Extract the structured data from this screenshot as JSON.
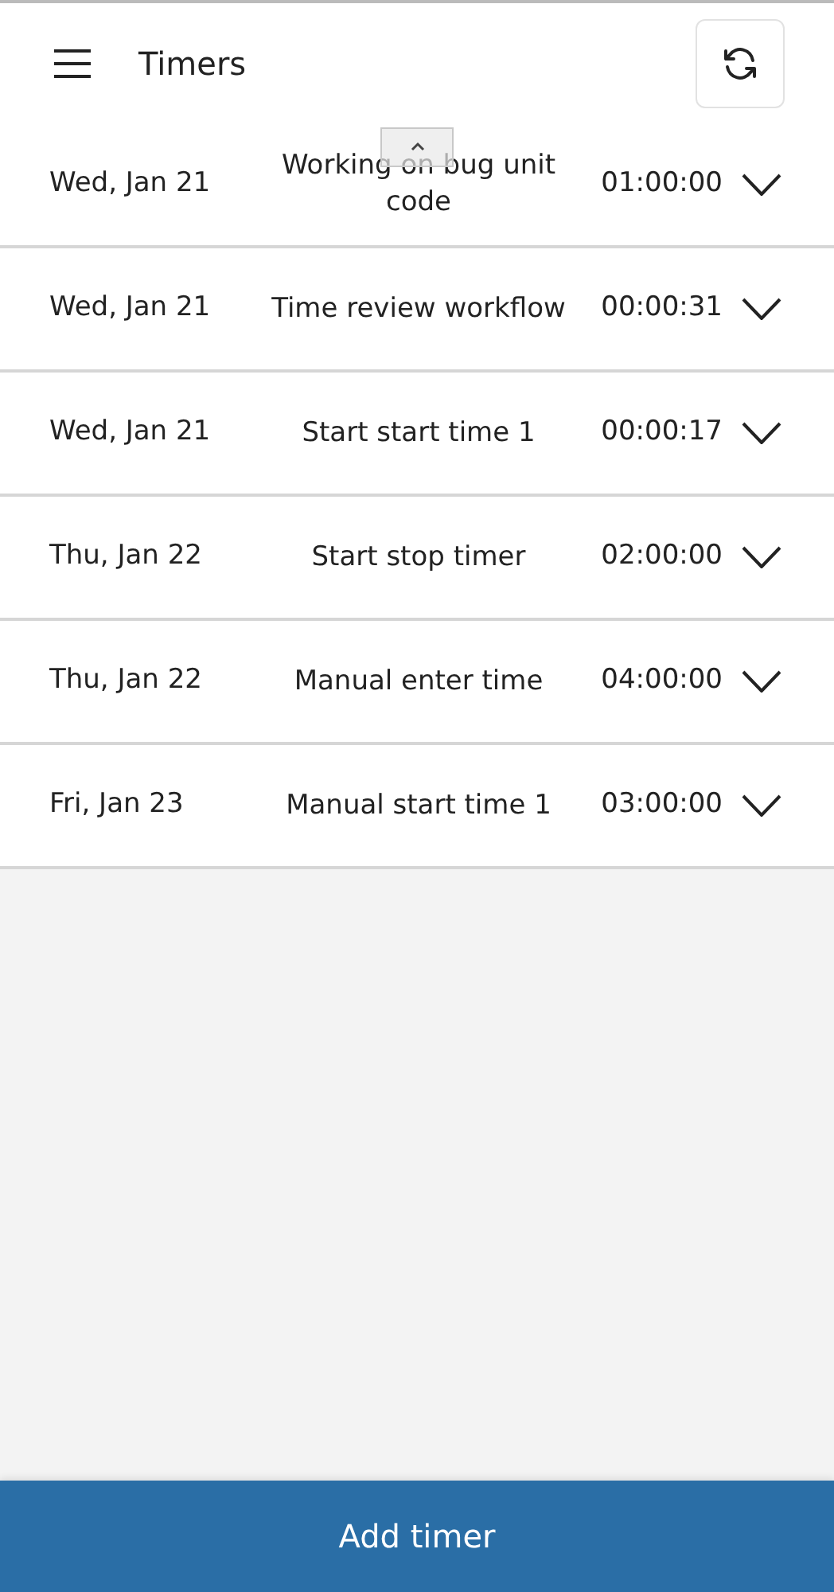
{
  "header": {
    "title": "Timers"
  },
  "timers": [
    {
      "date": "Wed, Jan 21",
      "title": "Working on bug unit code",
      "duration": "01:00:00"
    },
    {
      "date": "Wed, Jan 21",
      "title": "Time review workflow",
      "duration": "00:00:31"
    },
    {
      "date": "Wed, Jan 21",
      "title": "Start start time 1",
      "duration": "00:00:17"
    },
    {
      "date": "Thu, Jan 22",
      "title": "Start stop timer",
      "duration": "02:00:00"
    },
    {
      "date": "Thu, Jan 22",
      "title": "Manual enter time",
      "duration": "04:00:00"
    },
    {
      "date": "Fri, Jan 23",
      "title": "Manual start time 1",
      "duration": "03:00:00"
    }
  ],
  "add_button": "Add timer"
}
